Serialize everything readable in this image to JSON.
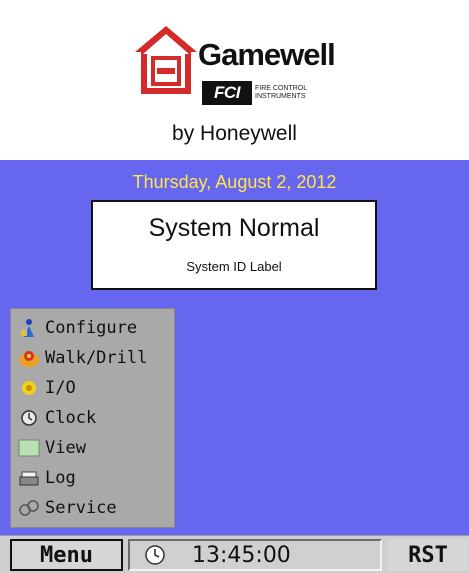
{
  "header": {
    "brand": "Gamewell",
    "fci_badge": "FCI",
    "fci_text": "FIRE CONTROL INSTRUMENTS",
    "byline": "by Honeywell"
  },
  "main": {
    "date": "Thursday, August 2, 2012",
    "status": "System Normal",
    "system_id_label": "System ID Label"
  },
  "menu": {
    "items": [
      {
        "label": "Configure",
        "icon": "configure-icon"
      },
      {
        "label": "Walk/Drill",
        "icon": "walk-drill-icon"
      },
      {
        "label": "I/O",
        "icon": "io-icon"
      },
      {
        "label": "Clock",
        "icon": "clock-icon"
      },
      {
        "label": "View",
        "icon": "view-icon"
      },
      {
        "label": "Log",
        "icon": "log-icon"
      },
      {
        "label": "Service",
        "icon": "service-icon"
      }
    ]
  },
  "taskbar": {
    "menu_label": "Menu",
    "time": "13:45:00",
    "rst_label": "RST"
  },
  "colors": {
    "panel": "#6666ee",
    "date_text": "#ffe64a",
    "logo_red": "#d42a2a"
  }
}
